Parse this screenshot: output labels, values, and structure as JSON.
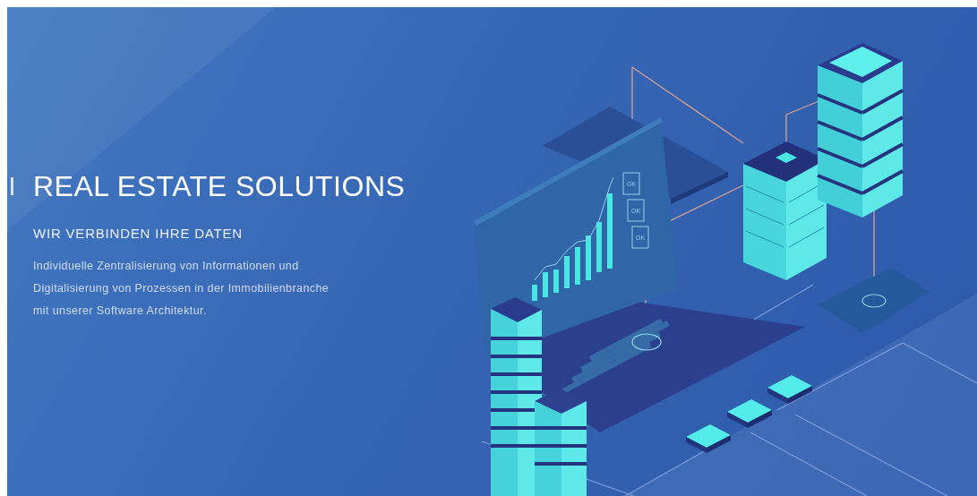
{
  "hero": {
    "title": "REAL ESTATE SOLUTIONS",
    "subtitle": "WIR VERBINDEN IHRE DATEN",
    "description": [
      "Individuelle Zentralisierung von Informationen und",
      "Digitalisierung von Prozessen in der Immobilienbranche",
      "mit unserer Software Architektur."
    ]
  },
  "illustration": {
    "status_labels": [
      "OK",
      "OK",
      "OK"
    ]
  }
}
